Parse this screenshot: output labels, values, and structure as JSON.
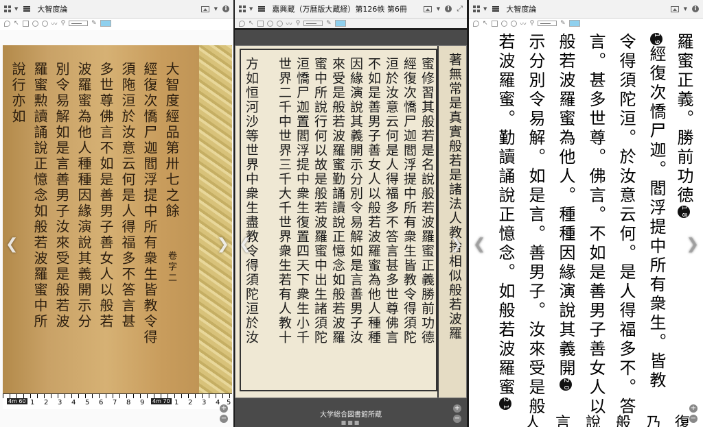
{
  "panels": [
    {
      "title": "大智度論",
      "columns": [
        "大智度經品第卅七之餘",
        "經復次憍尸迦閻浮提中所有衆生皆教令得",
        "須陁洹於汝意云何是人得福多不答言甚",
        "多世尊佛言不如是善男子善女人以般若",
        "波羅蜜為他人種種因緣演說其義開示分",
        "別令易解如是言善男子汝來受是般若波",
        "羅蜜勲讀誦說正憶念如般若波羅蜜中所",
        "說行亦如"
      ],
      "label_vol": "卷字二",
      "ruler": {
        "marks": [
          "1",
          "2",
          "3",
          "4",
          "5",
          "6",
          "7",
          "8",
          "9",
          "1",
          "2",
          "3",
          "4",
          "5"
        ],
        "badges": [
          "4m 60",
          "4m 70"
        ]
      }
    },
    {
      "title": "嘉興蔵（万暦版大蔵経）第126帙 第6冊",
      "columns": [
        "著無常是真實般若是諸法人教捨相似般若波羅",
        "蜜修習其般若是名說般若波羅蜜正義勝前功德",
        "經復次憍尸迦閻浮提中所有衆生皆教令得須陀",
        "洹於汝意云何是人得福多不答言甚多世尊佛言",
        "不如是善男子善女人以般若波羅蜜為他人種種",
        "因緣演說其義開示分別令易解如是言善男子汝",
        "來受是般若波羅蜜勤誦讀說正憶念如般若波羅",
        "蜜中所說行何以故是般若波羅蜜中出生諸須陀",
        "洹憍尸迦置閻浮提中衆生復置四天下衆生小千",
        "世界二千中世界三千大千世界衆生若有人教十",
        "方如恒河沙等世界中衆生盡教令得須陀洹於汝"
      ],
      "caption": "大学総合図書館所蔵"
    },
    {
      "title": "大智度論",
      "columns": [
        "羅蜜正義。勝前功徳",
        "經復次憍尸迦。閻浮提中所有衆生。皆教",
        "令得須陀洹。於汝意云何。是人得福多不。答",
        "言。甚多世尊。佛言。不如是善男子善女人以",
        "般若波羅蜜為他人。種種因緣演說其義開",
        "示分別令易解。如是言。善男子。汝來受是般",
        "若波羅蜜。勤讀誦說正憶念。如般若波羅蜜"
      ],
      "circled": [
        "18",
        "19",
        "20",
        "21"
      ],
      "bottom_fragments": [
        "復",
        "乃",
        "般",
        "說",
        "言",
        "人"
      ]
    }
  ],
  "toolbar": {
    "color": "#8fd0ee"
  },
  "icons": {
    "grid": "grid-icon",
    "menu": "hamburger-icon",
    "image": "image-icon",
    "info": "info-icon",
    "expand": "expand-icon"
  }
}
